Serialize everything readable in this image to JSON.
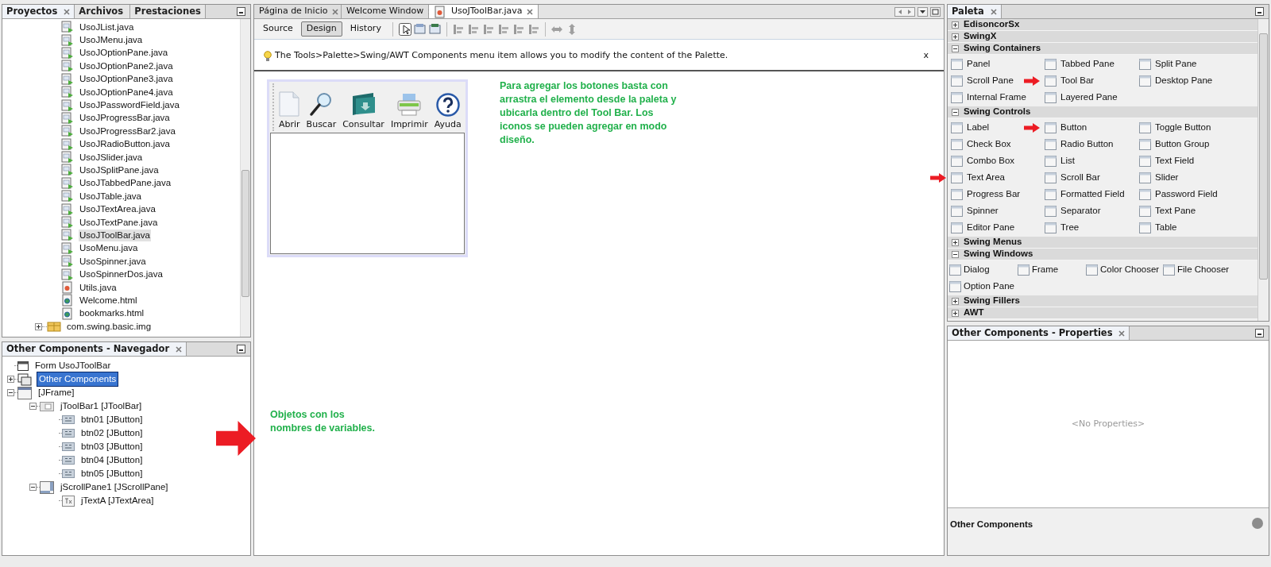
{
  "projects_panel": {
    "tabs": [
      {
        "label": "Proyectos",
        "selected": true
      },
      {
        "label": "Archivos",
        "selected": false
      },
      {
        "label": "Prestaciones",
        "selected": false
      }
    ],
    "items": [
      {
        "label": "UsoJList.java",
        "kind": "form",
        "selected": false
      },
      {
        "label": "UsoJMenu.java",
        "kind": "form",
        "selected": false
      },
      {
        "label": "UsoJOptionPane.java",
        "kind": "form",
        "selected": false
      },
      {
        "label": "UsoJOptionPane2.java",
        "kind": "form",
        "selected": false
      },
      {
        "label": "UsoJOptionPane3.java",
        "kind": "form",
        "selected": false
      },
      {
        "label": "UsoJOptionPane4.java",
        "kind": "form",
        "selected": false
      },
      {
        "label": "UsoJPasswordField.java",
        "kind": "form",
        "selected": false
      },
      {
        "label": "UsoJProgressBar.java",
        "kind": "form",
        "selected": false
      },
      {
        "label": "UsoJProgressBar2.java",
        "kind": "form",
        "selected": false
      },
      {
        "label": "UsoJRadioButton.java",
        "kind": "form",
        "selected": false
      },
      {
        "label": "UsoJSlider.java",
        "kind": "form",
        "selected": false
      },
      {
        "label": "UsoJSplitPane.java",
        "kind": "form",
        "selected": false
      },
      {
        "label": "UsoJTabbedPane.java",
        "kind": "form",
        "selected": false
      },
      {
        "label": "UsoJTable.java",
        "kind": "form",
        "selected": false
      },
      {
        "label": "UsoJTextArea.java",
        "kind": "form",
        "selected": false
      },
      {
        "label": "UsoJTextPane.java",
        "kind": "form",
        "selected": false
      },
      {
        "label": "UsoJToolBar.java",
        "kind": "form",
        "selected": true
      },
      {
        "label": "UsoMenu.java",
        "kind": "form",
        "selected": false
      },
      {
        "label": "UsoSpinner.java",
        "kind": "form",
        "selected": false
      },
      {
        "label": "UsoSpinnerDos.java",
        "kind": "form",
        "selected": false
      },
      {
        "label": "Utils.java",
        "kind": "class",
        "selected": false
      },
      {
        "label": "Welcome.html",
        "kind": "html",
        "selected": false
      },
      {
        "label": "bookmarks.html",
        "kind": "html",
        "selected": false
      },
      {
        "label": "com.swing.basic.img",
        "kind": "package",
        "selected": false
      }
    ]
  },
  "navigator": {
    "title": "Other Components - Navegador",
    "tree": [
      {
        "label": "Form UsoJToolBar",
        "kind": "form",
        "selected": false
      },
      {
        "label": "Other Components",
        "kind": "other",
        "selected": true,
        "expanded": false
      },
      {
        "label": "[JFrame]",
        "kind": "frame",
        "selected": false,
        "expanded": true,
        "children": [
          {
            "label": "jToolBar1 [JToolBar]",
            "kind": "toolbar",
            "selected": false,
            "expanded": true,
            "children": [
              {
                "label": "btn01 [JButton]",
                "kind": "button",
                "selected": false
              },
              {
                "label": "btn02 [JButton]",
                "kind": "button",
                "selected": false
              },
              {
                "label": "btn03 [JButton]",
                "kind": "button",
                "selected": false
              },
              {
                "label": "btn04 [JButton]",
                "kind": "button",
                "selected": false
              },
              {
                "label": "btn05 [JButton]",
                "kind": "button",
                "selected": false
              }
            ]
          },
          {
            "label": "jScrollPane1 [JScrollPane]",
            "kind": "scrollpane",
            "selected": false,
            "expanded": true,
            "children": [
              {
                "label": "jTextA [JTextArea]",
                "kind": "textarea",
                "selected": false
              }
            ]
          }
        ]
      }
    ],
    "note": "Objetos con los nombres de variables."
  },
  "editor": {
    "tabs": [
      {
        "label": "Página de Inicio",
        "selected": false
      },
      {
        "label": "Welcome Window",
        "selected": false
      },
      {
        "label": "UsoJToolBar.java",
        "selected": true
      }
    ],
    "views": [
      {
        "label": "Source",
        "selected": false
      },
      {
        "label": "Design",
        "selected": true
      },
      {
        "label": "History",
        "selected": false
      }
    ],
    "hint": "The Tools>Palette>Swing/AWT Components menu item allows you to modify the content of the Palette.",
    "hint_close": "x",
    "form_buttons": [
      {
        "label": "Abrir",
        "kind": "document"
      },
      {
        "label": "Buscar",
        "kind": "search"
      },
      {
        "label": "Consultar",
        "kind": "folder"
      },
      {
        "label": "Imprimir",
        "kind": "printer"
      },
      {
        "label": "Ayuda",
        "kind": "help"
      }
    ],
    "note": "Para agregar los botones basta con arrastra el elemento desde la paleta y ubicarla dentro del Tool Bar. Los iconos se pueden agregar en modo diseño."
  },
  "palette": {
    "title": "Paleta",
    "categories": [
      {
        "label": "EdisoncorSx",
        "expanded": false
      },
      {
        "label": "SwingX",
        "expanded": false
      },
      {
        "label": "Swing Containers",
        "expanded": true,
        "kind": "wide",
        "items": [
          {
            "label": "Panel",
            "marked": false
          },
          {
            "label": "Tabbed Pane",
            "marked": false
          },
          {
            "label": "Split Pane",
            "marked": false
          },
          {
            "label": "Scroll Pane",
            "marked": false
          },
          {
            "label": "Tool Bar",
            "marked": true
          },
          {
            "label": "Desktop Pane",
            "marked": false
          },
          {
            "label": "Internal Frame",
            "marked": false
          },
          {
            "label": "Layered Pane",
            "marked": false
          }
        ]
      },
      {
        "label": "Swing Controls",
        "expanded": true,
        "kind": "wide",
        "items": [
          {
            "label": "Label",
            "marked": false
          },
          {
            "label": "Button",
            "marked": true
          },
          {
            "label": "Toggle Button",
            "marked": false
          },
          {
            "label": "Check Box",
            "marked": false
          },
          {
            "label": "Radio Button",
            "marked": false
          },
          {
            "label": "Button Group",
            "marked": false
          },
          {
            "label": "Combo Box",
            "marked": false
          },
          {
            "label": "List",
            "marked": false
          },
          {
            "label": "Text Field",
            "marked": false
          },
          {
            "label": "Text Area",
            "marked": true
          },
          {
            "label": "Scroll Bar",
            "marked": false
          },
          {
            "label": "Slider",
            "marked": false
          },
          {
            "label": "Progress Bar",
            "marked": false
          },
          {
            "label": "Formatted Field",
            "marked": false
          },
          {
            "label": "Password Field",
            "marked": false
          },
          {
            "label": "Spinner",
            "marked": false
          },
          {
            "label": "Separator",
            "marked": false
          },
          {
            "label": "Text Pane",
            "marked": false
          },
          {
            "label": "Editor Pane",
            "marked": false
          },
          {
            "label": "Tree",
            "marked": false
          },
          {
            "label": "Table",
            "marked": false
          }
        ]
      },
      {
        "label": "Swing Menus",
        "expanded": false
      },
      {
        "label": "Swing Windows",
        "expanded": true,
        "kind": "narrow",
        "items": [
          {
            "label": "Dialog",
            "marked": false
          },
          {
            "label": "Frame",
            "marked": false
          },
          {
            "label": "Color Chooser",
            "marked": false
          },
          {
            "label": "File Chooser",
            "marked": false
          },
          {
            "label": "Option Pane",
            "marked": false
          }
        ]
      },
      {
        "label": "Swing Fillers",
        "expanded": false
      },
      {
        "label": "AWT",
        "expanded": false
      }
    ]
  },
  "properties": {
    "title": "Other Components - Properties",
    "empty": "<No Properties>",
    "footer": "Other Components"
  }
}
